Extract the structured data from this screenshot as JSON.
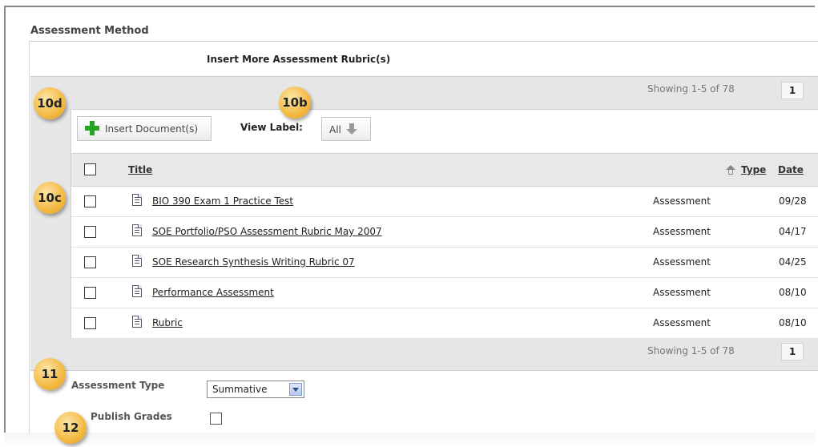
{
  "section": {
    "title": "Assessment Method",
    "insert_more": "Insert More Assessment Rubric(s)"
  },
  "pager": {
    "showing_top": "Showing 1-5 of 78",
    "page_top": "1",
    "showing_bottom": "Showing 1-5 of 78",
    "page_bottom": "1"
  },
  "toolbar": {
    "insert_label": "Insert Document(s)",
    "view_label": "View Label:",
    "view_value": "All"
  },
  "table": {
    "headers": {
      "title": "Title",
      "type": "Type",
      "date": "Date"
    },
    "rows": [
      {
        "title": "BIO 390 Exam 1 Practice Test",
        "type": "Assessment",
        "date": "09/28"
      },
      {
        "title": "SOE Portfolio/PSO Assessment Rubric May 2007",
        "type": "Assessment",
        "date": "04/17"
      },
      {
        "title": "SOE Research Synthesis Writing Rubric 07",
        "type": "Assessment",
        "date": "04/25"
      },
      {
        "title": "Performance Assessment",
        "type": "Assessment",
        "date": "08/10"
      },
      {
        "title": "Rubric",
        "type": "Assessment",
        "date": "08/10"
      }
    ]
  },
  "form": {
    "assessment_type_label": "Assessment Type",
    "assessment_type_value": "Summative",
    "publish_grades_label": "Publish Grades"
  },
  "callouts": {
    "c10d": "10d",
    "c10b": "10b",
    "c10c": "10c",
    "c11": "11",
    "c12": "12"
  },
  "colors": {
    "callout": "#f3b941",
    "plus": "#25a525"
  }
}
